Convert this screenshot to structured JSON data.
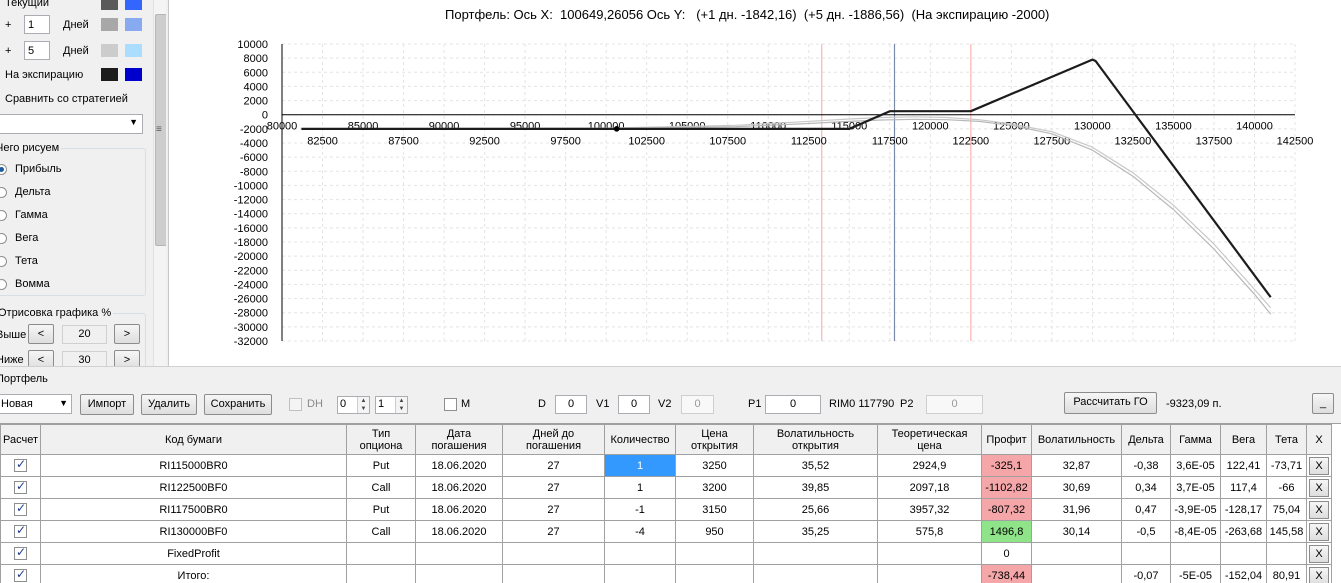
{
  "left_panel": {
    "current_label": "Текущий",
    "rows": [
      {
        "prefix": "+",
        "days": "1",
        "unit": "Дней"
      },
      {
        "prefix": "+",
        "days": "5",
        "unit": "Дней"
      }
    ],
    "expiration_label": "На экспирацию",
    "compare_label": "Сравнить со стратегией",
    "compare_select_value": "",
    "draw_group_title": "Чего рисуем",
    "draw_options": [
      "Прибыль",
      "Дельта",
      "Гамма",
      "Вега",
      "Тета",
      "Вомма"
    ],
    "draw_selected": "Прибыль",
    "render_group_title": "Отрисовка графика %",
    "above_label": "Выше",
    "above_value": "20",
    "below_label": "Ниже",
    "below_value": "30",
    "dec_symbol": "<",
    "inc_symbol": ">",
    "colors": {
      "current_dark": "#5a5a5a",
      "current_light": "#3366ff",
      "d1_dark": "#a8a8a8",
      "d1_light": "#88aaf0",
      "d5_dark": "#cccccc",
      "d5_light": "#aaddff",
      "exp_dark": "#1c1c1c",
      "exp_light": "#0000cc"
    }
  },
  "chart": {
    "title": "Портфель: Ось X:  100649,26056 Ось Y:   (+1 дн. -1842,16)  (+5 дн. -1886,56)  (На экспирацию -2000)"
  },
  "chart_data": {
    "type": "line",
    "title": "Портфель: Ось X:  100649,26056 Ось Y:   (+1 дн. -1842,16)  (+5 дн. -1886,56)  (На экспирацию -2000)",
    "xlim": [
      80000,
      142500
    ],
    "ylim": [
      -32000,
      10000
    ],
    "x_ticks_upper": [
      80000,
      85000,
      90000,
      95000,
      100000,
      105000,
      110000,
      115000,
      120000,
      125000,
      130000,
      135000,
      140000
    ],
    "x_ticks_lower": [
      82500,
      87500,
      92500,
      97500,
      102500,
      107500,
      112500,
      117500,
      122500,
      127500,
      132500,
      137500,
      142500
    ],
    "y_ticks": [
      10000,
      8000,
      6000,
      4000,
      2000,
      0,
      -2000,
      -4000,
      -6000,
      -8000,
      -10000,
      -12000,
      -14000,
      -16000,
      -18000,
      -20000,
      -22000,
      -24000,
      -26000,
      -28000,
      -30000,
      -32000
    ],
    "grid": true,
    "vertical_lines": [
      {
        "x": 113300,
        "color": "#ffb3b3"
      },
      {
        "x": 117790,
        "color": "#7a8aa8"
      },
      {
        "x": 122500,
        "color": "#ffb3b3"
      }
    ],
    "cursor_point": {
      "x": 100649,
      "y": -2000
    },
    "series": [
      {
        "color": "#1c1c1c",
        "width": 2.2,
        "x": [
          81200,
          115000,
          117500,
          122500,
          130000,
          130200,
          141000
        ],
        "y": [
          -2000,
          -2000,
          500,
          500,
          7800,
          7600,
          -25800
        ]
      },
      {
        "color": "#c8c8c8",
        "width": 1.2,
        "x": [
          81200,
          100000,
          108000,
          112000,
          115000,
          117000,
          119000,
          121000,
          123000,
          125000,
          127500,
          130000,
          132500,
          135000,
          137500,
          140000,
          141000
        ],
        "y": [
          -1990,
          -1900,
          -1500,
          -1000,
          -600,
          -400,
          -300,
          -400,
          -700,
          -1300,
          -2400,
          -4600,
          -8200,
          -12800,
          -18300,
          -24700,
          -27300
        ]
      },
      {
        "color": "#b8b8b8",
        "width": 1.2,
        "x": [
          81200,
          100000,
          108000,
          112000,
          115000,
          117000,
          119000,
          121000,
          123000,
          125000,
          127500,
          130000,
          132500,
          135000,
          137500,
          140000,
          141000
        ],
        "y": [
          -1995,
          -1960,
          -1700,
          -1300,
          -950,
          -750,
          -650,
          -700,
          -950,
          -1500,
          -2700,
          -5000,
          -8700,
          -13400,
          -19000,
          -25400,
          -28200
        ]
      }
    ]
  },
  "portfolio": {
    "group_title": "Портфель",
    "select_value": "Новая",
    "import_label": "Импорт",
    "delete_label": "Удалить",
    "save_label": "Сохранить",
    "dh_label": "DH",
    "spin1_value": "0",
    "spin2_value": "1",
    "m_label": "M",
    "d_label": "D",
    "d_value": "0",
    "v1_label": "V1",
    "v1_value": "0",
    "v2_label": "V2",
    "v2_value": "0",
    "p1_label": "P1",
    "p1_value": "0",
    "instrument_label": "RIM0 117790",
    "p2_label": "P2",
    "p2_value": "0",
    "calc_go_label": "Рассчитать ГО",
    "go_value": "-9323,09 п.",
    "minimize_label": "_"
  },
  "table": {
    "headers": [
      "Расчет",
      "Код бумаги",
      "Тип опциона",
      "Дата погашения",
      "Дней до погашения",
      "Количество",
      "Цена открытия",
      "Волатильность открытия",
      "Теоретическая цена",
      "Профит",
      "Волатильность",
      "Дельта",
      "Гамма",
      "Вега",
      "Тета",
      "X"
    ],
    "rows": [
      {
        "code": "RI115000BR0",
        "type": "Put",
        "date": "18.06.2020",
        "days": "27",
        "qty": "1",
        "price": "3250",
        "vol_open": "35,52",
        "theo": "2924,9",
        "profit": "-325,1",
        "vol": "32,87",
        "delta": "-0,38",
        "gamma": "3,6E-05",
        "vega": "122,41",
        "theta": "-73,71",
        "x": "X"
      },
      {
        "code": "RI122500BF0",
        "type": "Call",
        "date": "18.06.2020",
        "days": "27",
        "qty": "1",
        "price": "3200",
        "vol_open": "39,85",
        "theo": "2097,18",
        "profit": "-1102,82",
        "vol": "30,69",
        "delta": "0,34",
        "gamma": "3,7E-05",
        "vega": "117,4",
        "theta": "-66",
        "x": "X"
      },
      {
        "code": "RI117500BR0",
        "type": "Put",
        "date": "18.06.2020",
        "days": "27",
        "qty": "-1",
        "price": "3150",
        "vol_open": "25,66",
        "theo": "3957,32",
        "profit": "-807,32",
        "vol": "31,96",
        "delta": "0,47",
        "gamma": "-3,9E-05",
        "vega": "-128,17",
        "theta": "75,04",
        "x": "X"
      },
      {
        "code": "RI130000BF0",
        "type": "Call",
        "date": "18.06.2020",
        "days": "27",
        "qty": "-4",
        "price": "950",
        "vol_open": "35,25",
        "theo": "575,8",
        "profit": "1496,8",
        "vol": "30,14",
        "delta": "-0,5",
        "gamma": "-8,4E-05",
        "vega": "-263,68",
        "theta": "145,58",
        "x": "X"
      }
    ],
    "fixed_row": {
      "code": "FixedProfit",
      "profit": "0",
      "x": "X"
    },
    "total_row": {
      "code": "Итого:",
      "profit": "-738,44",
      "delta": "-0,07",
      "gamma": "-5E-05",
      "vega": "-152,04",
      "theta": "80,91",
      "x": "X"
    }
  }
}
